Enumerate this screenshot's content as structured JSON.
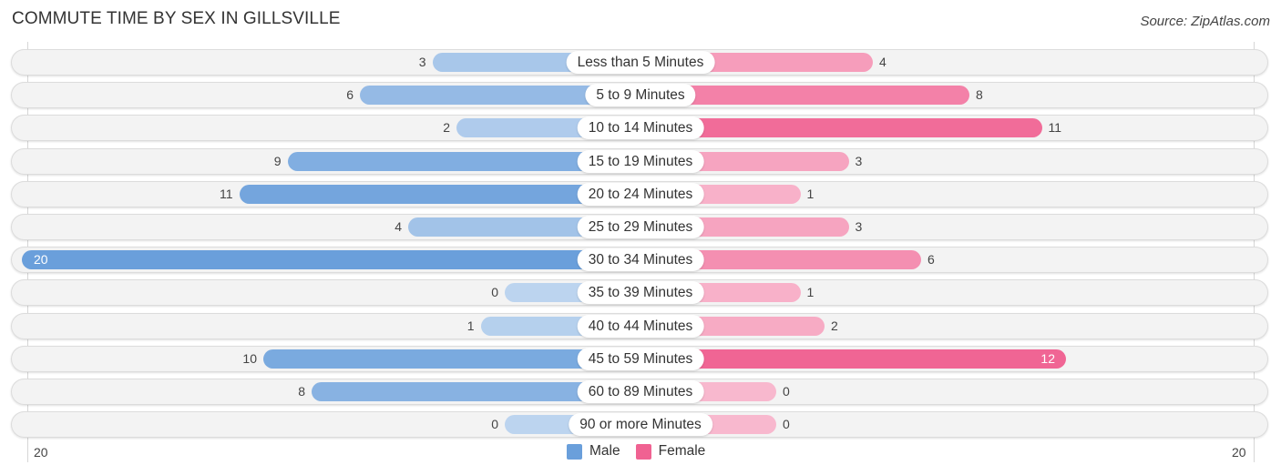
{
  "title": "COMMUTE TIME BY SEX IN GILLSVILLE",
  "source": "Source: ZipAtlas.com",
  "chart_data": {
    "type": "bar",
    "orientation": "horizontal-diverging",
    "title": "COMMUTE TIME BY SEX IN GILLSVILLE",
    "categories": [
      "Less than 5 Minutes",
      "5 to 9 Minutes",
      "10 to 14 Minutes",
      "15 to 19 Minutes",
      "20 to 24 Minutes",
      "25 to 29 Minutes",
      "30 to 34 Minutes",
      "35 to 39 Minutes",
      "40 to 44 Minutes",
      "45 to 59 Minutes",
      "60 to 89 Minutes",
      "90 or more Minutes"
    ],
    "series": [
      {
        "name": "Male",
        "color": "#6a9fdb",
        "values": [
          3,
          6,
          2,
          9,
          11,
          4,
          20,
          0,
          1,
          10,
          8,
          0
        ]
      },
      {
        "name": "Female",
        "color": "#f06292",
        "values": [
          4,
          8,
          11,
          3,
          1,
          3,
          6,
          1,
          2,
          12,
          0,
          0
        ]
      }
    ],
    "axis_range": [
      20,
      20
    ],
    "axis_labels": {
      "left": "20",
      "right": "20"
    },
    "legend": {
      "position": "bottom-center",
      "entries": [
        "Male",
        "Female"
      ]
    }
  }
}
